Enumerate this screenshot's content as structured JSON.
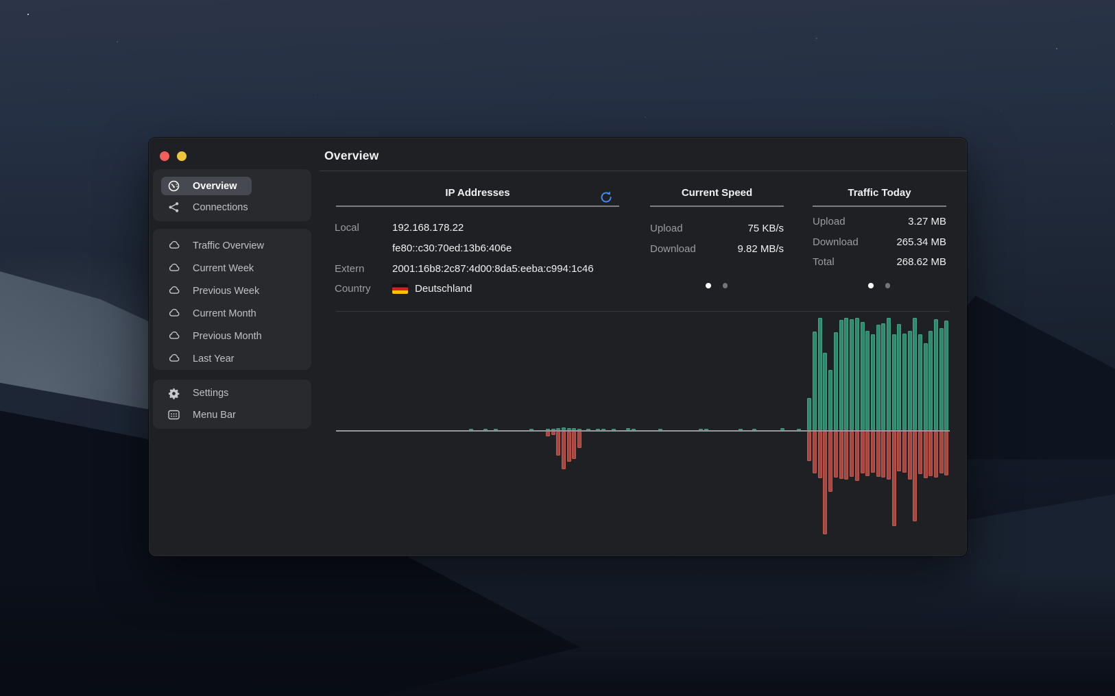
{
  "window": {
    "title": "Overview"
  },
  "titlebar": {
    "buttons": [
      "close",
      "minimize"
    ]
  },
  "sidebar": {
    "groups": [
      {
        "items": [
          {
            "icon": "gauge",
            "label": "Overview",
            "selected": true
          },
          {
            "icon": "share",
            "label": "Connections",
            "selected": false
          }
        ]
      },
      {
        "items": [
          {
            "icon": "cloud",
            "label": "Traffic Overview",
            "selected": false
          },
          {
            "icon": "cloud",
            "label": "Current Week",
            "selected": false
          },
          {
            "icon": "cloud",
            "label": "Previous Week",
            "selected": false
          },
          {
            "icon": "cloud",
            "label": "Current Month",
            "selected": false
          },
          {
            "icon": "cloud",
            "label": "Previous Month",
            "selected": false
          },
          {
            "icon": "cloud",
            "label": "Last Year",
            "selected": false
          }
        ]
      },
      {
        "items": [
          {
            "icon": "gear",
            "label": "Settings",
            "selected": false
          },
          {
            "icon": "menubar",
            "label": "Menu Bar",
            "selected": false
          }
        ]
      }
    ]
  },
  "panels": {
    "ip": {
      "title": "IP Addresses",
      "rows": [
        {
          "label": "Local",
          "value": "192.168.178.22"
        },
        {
          "label": "",
          "value": "fe80::c30:70ed:13b6:406e"
        },
        {
          "label": "Extern",
          "value": "2001:16b8:2c87:4d00:8da5:eeba:c994:1c46"
        },
        {
          "label": "Country",
          "value": "Deutschland",
          "flag": "germany"
        }
      ]
    },
    "speed": {
      "title": "Current Speed",
      "rows": [
        {
          "label": "Upload",
          "value": "75 KB/s"
        },
        {
          "label": "Download",
          "value": "9.82 MB/s"
        }
      ],
      "pager": {
        "count": 2,
        "active": 0
      }
    },
    "traffic": {
      "title": "Traffic Today",
      "rows": [
        {
          "label": "Upload",
          "value": "3.27 MB"
        },
        {
          "label": "Download",
          "value": "265.34 MB"
        },
        {
          "label": "Total",
          "value": "268.62 MB"
        }
      ],
      "pager": {
        "count": 2,
        "active": 0
      }
    }
  },
  "chart_data": {
    "type": "bar",
    "orientation": "diverging",
    "up_series": "download",
    "down_series": "upload",
    "unit": "relative height in px (chart has no visible axis labels)",
    "up_color": "#2c8a6e",
    "down_color": "#a8473f",
    "axis": "horizontal baseline, no ticks or labels",
    "bars": [
      [
        197,
        2,
        0
      ],
      [
        218,
        2,
        0
      ],
      [
        233,
        2,
        0
      ],
      [
        285,
        2,
        0
      ],
      [
        309,
        2,
        7
      ],
      [
        317,
        2,
        5
      ],
      [
        324,
        3,
        35
      ],
      [
        332,
        4,
        55
      ],
      [
        340,
        3,
        44
      ],
      [
        347,
        3,
        40
      ],
      [
        355,
        2,
        24
      ],
      [
        368,
        2,
        0
      ],
      [
        382,
        2,
        0
      ],
      [
        390,
        2,
        0
      ],
      [
        405,
        2,
        0
      ],
      [
        426,
        3,
        0
      ],
      [
        434,
        2,
        0
      ],
      [
        473,
        2,
        0
      ],
      [
        532,
        2,
        0
      ],
      [
        540,
        2,
        0
      ],
      [
        590,
        2,
        0
      ],
      [
        610,
        2,
        0
      ],
      [
        651,
        3,
        0
      ],
      [
        675,
        2,
        0
      ],
      [
        690,
        47,
        43
      ],
      [
        698,
        144,
        61
      ],
      [
        706,
        164,
        68
      ],
      [
        713,
        113,
        150
      ],
      [
        721,
        88,
        88
      ],
      [
        729,
        143,
        67
      ],
      [
        737,
        161,
        69
      ],
      [
        744,
        164,
        70
      ],
      [
        752,
        162,
        66
      ],
      [
        760,
        164,
        72
      ],
      [
        768,
        158,
        61
      ],
      [
        775,
        145,
        65
      ],
      [
        783,
        140,
        60
      ],
      [
        791,
        154,
        66
      ],
      [
        798,
        156,
        67
      ],
      [
        806,
        164,
        70
      ],
      [
        814,
        140,
        138
      ],
      [
        821,
        155,
        58
      ],
      [
        829,
        141,
        60
      ],
      [
        837,
        145,
        70
      ],
      [
        844,
        164,
        131
      ],
      [
        852,
        140,
        62
      ],
      [
        860,
        127,
        68
      ],
      [
        867,
        145,
        65
      ],
      [
        875,
        162,
        67
      ],
      [
        883,
        149,
        61
      ],
      [
        890,
        160,
        64
      ]
    ]
  },
  "colors": {
    "accent_blue": "#3f8df2",
    "bar_green": "#2c8a6e",
    "bar_red": "#a8473f",
    "traffic_light_red": "#f3605a",
    "traffic_light_yellow": "#eec43d"
  }
}
